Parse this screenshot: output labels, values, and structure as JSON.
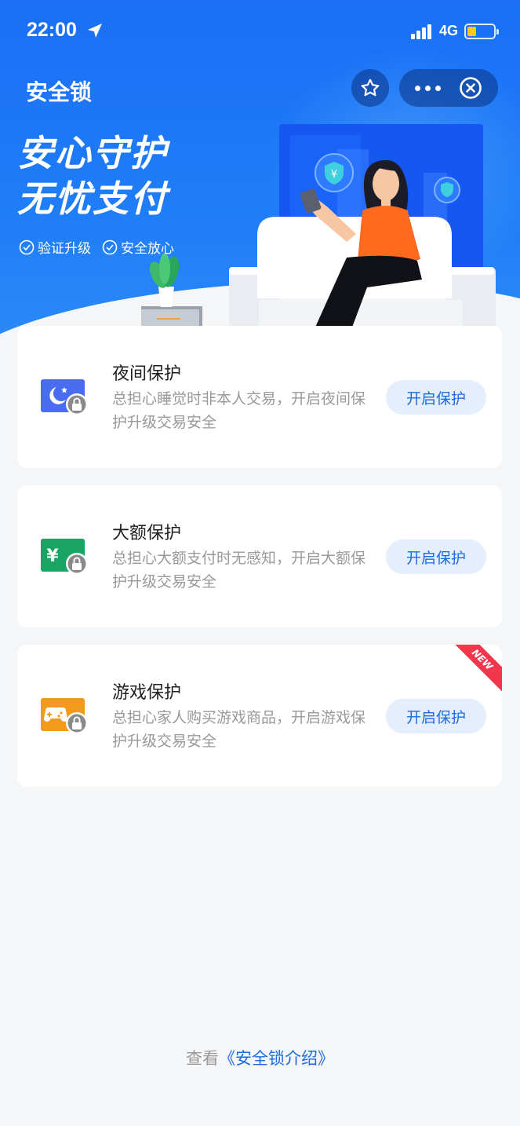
{
  "status_bar": {
    "time": "22:00",
    "network": "4G",
    "battery_level": 0.35
  },
  "nav": {
    "title": "安全锁"
  },
  "hero": {
    "slogan_line1": "安心守护",
    "slogan_line2": "无忧支付",
    "tags": [
      "验证升级",
      "安全放心"
    ]
  },
  "cards": [
    {
      "title": "夜间保护",
      "desc": "总担心睡觉时非本人交易，开启夜间保护升级交易安全",
      "button": "开启保护",
      "icon": "moon-lock-icon",
      "color": "#4a6cf0"
    },
    {
      "title": "大额保护",
      "desc": "总担心大额支付时无感知，开启大额保护升级交易安全",
      "button": "开启保护",
      "icon": "yuan-lock-icon",
      "color": "#1aa463"
    },
    {
      "title": "游戏保护",
      "desc": "总担心家人购买游戏商品，开启游戏保护升级交易安全",
      "button": "开启保护",
      "icon": "gamepad-lock-icon",
      "color": "#f39a1c",
      "badge": "NEW"
    }
  ],
  "footer": {
    "prefix": "查看",
    "link": "《安全锁介绍》"
  }
}
